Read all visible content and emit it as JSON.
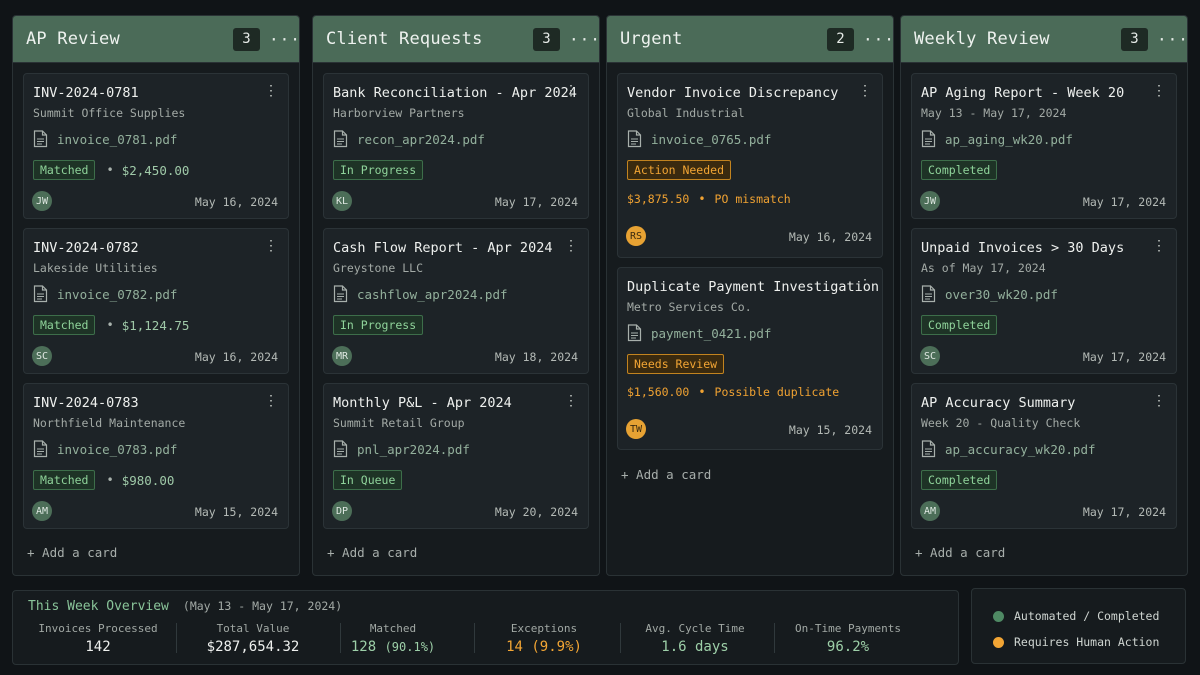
{
  "columns": [
    {
      "title": "AP Review",
      "count": "3",
      "more": "···",
      "add_label": "+ Add a card",
      "cards": [
        {
          "title": "INV-2024-0781",
          "subtitle": "Summit Office Supplies",
          "file": "invoice_0781.pdf",
          "status": "Matched",
          "amount": "$2,450.00",
          "avatar": "JW",
          "date": "May 16, 2024"
        },
        {
          "title": "INV-2024-0782",
          "subtitle": "Lakeside Utilities",
          "file": "invoice_0782.pdf",
          "status": "Matched",
          "amount": "$1,124.75",
          "avatar": "SC",
          "date": "May 16, 2024"
        },
        {
          "title": "INV-2024-0783",
          "subtitle": "Northfield Maintenance",
          "file": "invoice_0783.pdf",
          "status": "Matched",
          "amount": "$980.00",
          "avatar": "AM",
          "date": "May 15, 2024"
        }
      ]
    },
    {
      "title": "Client Requests",
      "count": "3",
      "more": "···",
      "add_label": "+ Add a card",
      "cards": [
        {
          "title": "Bank Reconciliation - Apr 2024",
          "subtitle": "Harborview Partners",
          "file": "recon_apr2024.pdf",
          "status": "In Progress",
          "avatar": "KL",
          "date": "May 17, 2024"
        },
        {
          "title": "Cash Flow Report - Apr 2024",
          "subtitle": "Greystone LLC",
          "file": "cashflow_apr2024.pdf",
          "status": "In Progress",
          "avatar": "MR",
          "date": "May 18, 2024"
        },
        {
          "title": "Monthly P&L - Apr 2024",
          "subtitle": "Summit Retail Group",
          "file": "pnl_apr2024.pdf",
          "status": "In Queue",
          "avatar": "DP",
          "date": "May 20, 2024"
        }
      ]
    },
    {
      "title": "Urgent",
      "count": "2",
      "more": "···",
      "add_label": "+ Add a card",
      "cards": [
        {
          "title": "Vendor Invoice Discrepancy",
          "subtitle": "Global Industrial",
          "file": "invoice_0765.pdf",
          "status": "Action Needed",
          "amount": "$3,875.50",
          "note": "PO mismatch",
          "avatar": "RS",
          "date": "May 16, 2024"
        },
        {
          "title": "Duplicate Payment Investigation",
          "subtitle": "Metro Services Co.",
          "file": "payment_0421.pdf",
          "status": "Needs Review",
          "amount": "$1,560.00",
          "note": "Possible duplicate",
          "avatar": "TW",
          "date": "May 15, 2024"
        }
      ]
    },
    {
      "title": "Weekly Review",
      "count": "3",
      "more": "···",
      "add_label": "+ Add a card",
      "cards": [
        {
          "title": "AP Aging Report - Week 20",
          "subtitle": "May 13 - May 17, 2024",
          "file": "ap_aging_wk20.pdf",
          "status": "Completed",
          "avatar": "JW",
          "date": "May 17, 2024"
        },
        {
          "title": "Unpaid Invoices > 30 Days",
          "subtitle": "As of May 17, 2024",
          "file": "over30_wk20.pdf",
          "status": "Completed",
          "avatar": "SC",
          "date": "May 17, 2024"
        },
        {
          "title": "AP Accuracy Summary",
          "subtitle": "Week 20 - Quality Check",
          "file": "ap_accuracy_wk20.pdf",
          "status": "Completed",
          "avatar": "AM",
          "date": "May 17, 2024"
        }
      ]
    }
  ],
  "card_menu": "⋮",
  "separator": "•",
  "overview": {
    "title": "This Week Overview",
    "range": "(May 13 - May 17, 2024)",
    "stats": [
      {
        "label": "Invoices Processed",
        "value": "142",
        "pct": ""
      },
      {
        "label": "Total Value",
        "value": "$287,654.32",
        "pct": ""
      },
      {
        "label": "Matched",
        "value": "128",
        "pct": "(90.1%)"
      },
      {
        "label": "Exceptions",
        "value": "14 (9.9%)",
        "pct": ""
      },
      {
        "label": "Avg. Cycle Time",
        "value": "1.6 days",
        "pct": ""
      },
      {
        "label": "On-Time Payments",
        "value": "96.2%",
        "pct": ""
      }
    ]
  },
  "legend": [
    {
      "label": "Automated / Completed",
      "color": "#4f8a64"
    },
    {
      "label": "Requires Human Action",
      "color": "#f2a534"
    }
  ],
  "colors": {
    "header": "#4b6b58",
    "success_badge": "#8fd39a",
    "warning_badge": "#f2a534"
  }
}
